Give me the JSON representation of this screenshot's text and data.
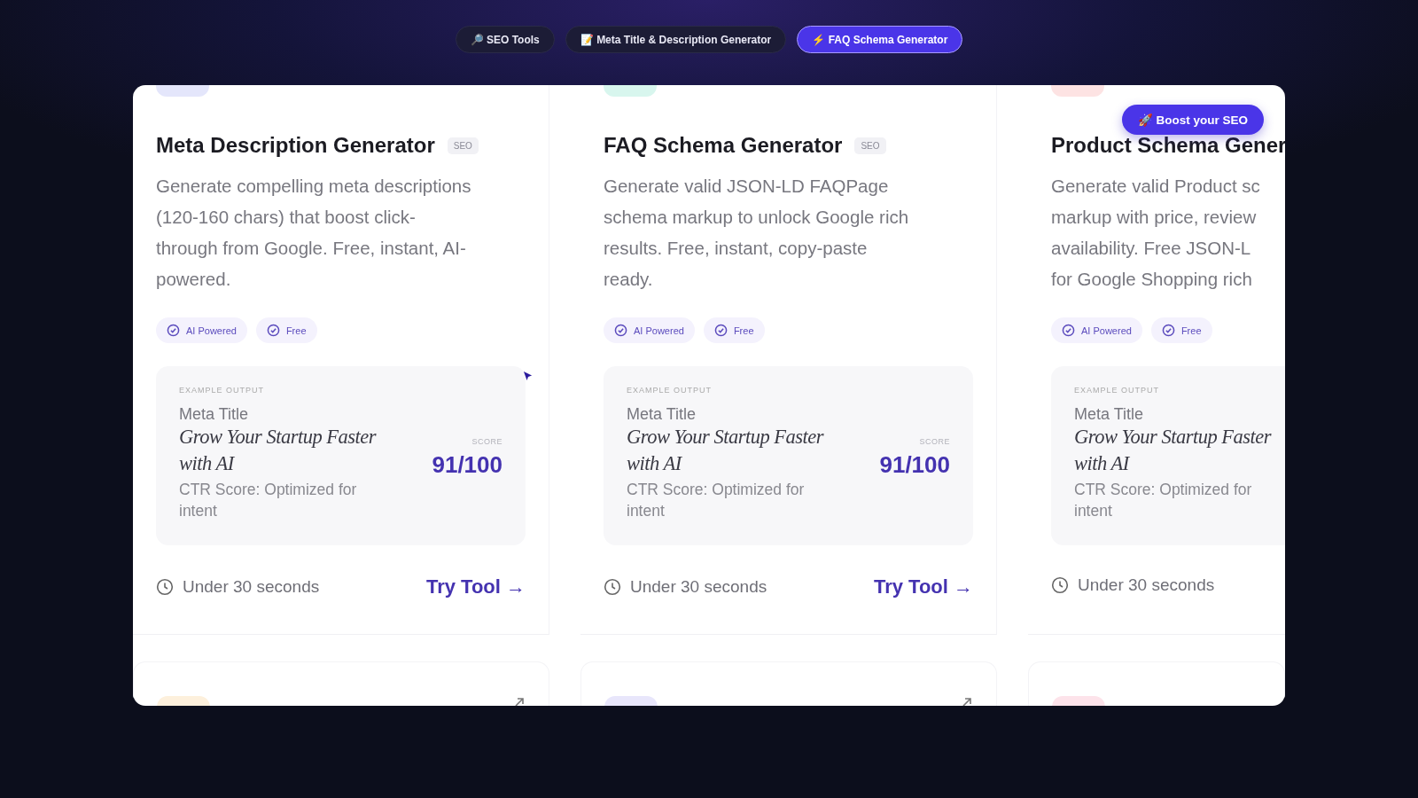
{
  "nav_tabs": [
    {
      "icon": "🔎",
      "label": "SEO Tools",
      "selected": false
    },
    {
      "icon": "📝",
      "label": "Meta Title & Description Generator",
      "selected": false
    },
    {
      "icon": "⚡",
      "label": "FAQ Schema Generator",
      "selected": true
    }
  ],
  "promo_button": {
    "icon": "🚀",
    "label": "Boost your SEO"
  },
  "cards": [
    {
      "color": "#e4e6fb",
      "title": "Meta Description Generator",
      "tag": "SEO",
      "description_lines": [
        "Generate compelling meta descriptions",
        "(120-160 chars) that boost click-",
        "through from Google. Free, instant, AI-",
        "powered."
      ],
      "chips": [
        "AI Powered",
        "Free"
      ],
      "example": {
        "label": "EXAMPLE OUTPUT",
        "field": "Meta Title",
        "headline_lines": [
          "Grow Your Startup Faster",
          "with AI"
        ],
        "note_lines": [
          "CTR Score: Optimized for",
          "intent"
        ],
        "score_label": "SCORE",
        "score": "91/100"
      },
      "time": "Under 30 seconds",
      "action": "Try Tool →"
    },
    {
      "color": "#d8f6ee",
      "title": "FAQ Schema Generator",
      "tag": "SEO",
      "description_lines": [
        "Generate valid JSON-LD FAQPage",
        "schema markup to unlock Google rich",
        "results. Free, instant, copy-paste",
        "ready."
      ],
      "chips": [
        "AI Powered",
        "Free"
      ],
      "example": {
        "label": "EXAMPLE OUTPUT",
        "field": "Meta Title",
        "headline_lines": [
          "Grow Your Startup Faster",
          "with AI"
        ],
        "note_lines": [
          "CTR Score: Optimized for",
          "intent"
        ],
        "score_label": "SCORE",
        "score": "91/100"
      },
      "time": "Under 30 seconds",
      "action": "Try Tool →"
    },
    {
      "color": "#fde3e3",
      "title": "Product Schema Gener",
      "description_lines": [
        "Generate valid Product sc",
        "markup with price, review",
        "availability. Free JSON-L",
        "for Google Shopping rich"
      ],
      "chips": [
        "AI Powered",
        "Free"
      ],
      "example": {
        "label": "EXAMPLE OUTPUT",
        "field": "Meta Title",
        "headline_lines": [
          "Grow Your Startup Faster",
          "with AI"
        ],
        "note_lines": [
          "CTR Score: Optimized for",
          "intent"
        ]
      },
      "time": "Under 30 seconds"
    }
  ],
  "next_cards": [
    {
      "color": "#fdf0dc",
      "arrow": true
    },
    {
      "color": "#e8e6fb",
      "arrow": true
    },
    {
      "color": "#fde3ea",
      "arrow": false
    }
  ]
}
